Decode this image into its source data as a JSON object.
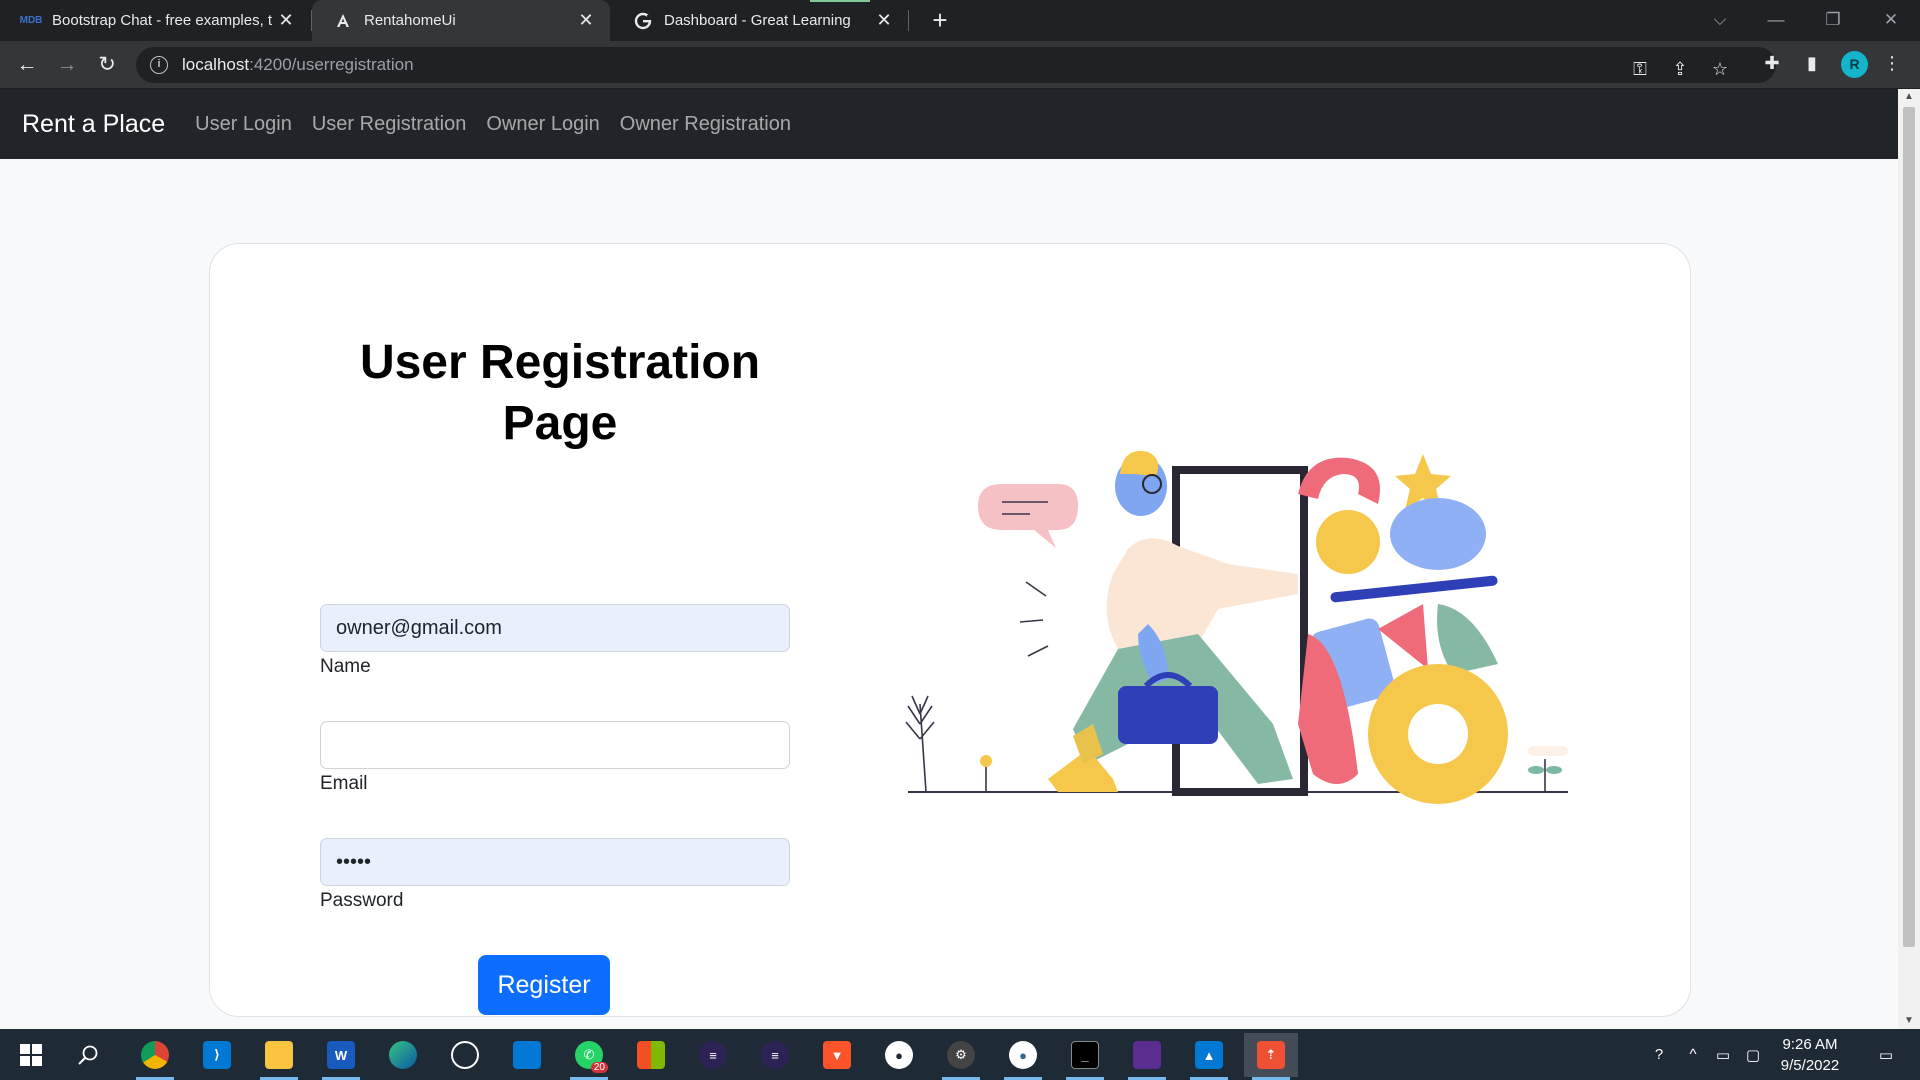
{
  "browser": {
    "tabs": [
      {
        "title": "Bootstrap Chat - free examples, t",
        "icon": "mdb-icon"
      },
      {
        "title": "RentahomeUi",
        "icon": "angular-icon"
      },
      {
        "title": "Dashboard - Great Learning",
        "icon": "google-icon"
      }
    ],
    "url_host": "localhost",
    "url_path": ":4200/userregistration",
    "profile_initial": "R"
  },
  "navbar": {
    "brand": "Rent a Place",
    "links": [
      "User Login",
      "User Registration",
      "Owner Login",
      "Owner Registration"
    ]
  },
  "form": {
    "title": "User Registration Page",
    "name_value": "owner@gmail.com",
    "name_label": "Name",
    "email_value": "",
    "email_label": "Email",
    "password_value": "•••••",
    "password_label": "Password",
    "submit_label": "Register"
  },
  "taskbar": {
    "apps": [
      "start-icon",
      "search-icon",
      "chrome-icon",
      "vscode-icon",
      "file-explorer-icon",
      "word-icon",
      "edge-icon",
      "github-desktop-icon",
      "store-icon",
      "whatsapp-icon",
      "microsoft-office-icon",
      "eclipse-icon",
      "eclipse-alt-icon",
      "brave-icon",
      "postman-icon",
      "settings-icon",
      "pgadmin-icon",
      "terminal-icon",
      "app-icon",
      "photos-icon",
      "git-icon"
    ],
    "whatsapp_badge": "20",
    "time": "9:26 AM",
    "date": "9/5/2022"
  },
  "colors": {
    "navbar_bg": "#212529",
    "primary": "#0d6efd",
    "autofill_bg": "#e8f0fe"
  }
}
